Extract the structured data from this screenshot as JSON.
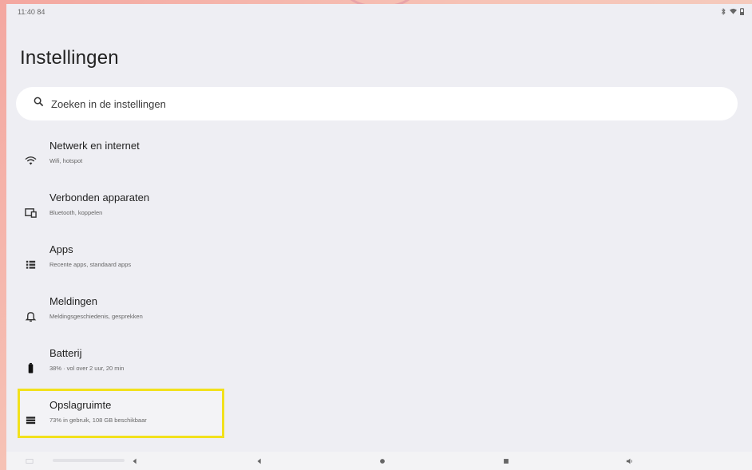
{
  "status_bar": {
    "time": "11:40 84",
    "icons": [
      "bluetooth-icon",
      "wifi-icon",
      "battery-icon"
    ]
  },
  "page_title": "Instellingen",
  "search": {
    "placeholder": "Zoeken in de instellingen",
    "icon": "search-icon"
  },
  "items": [
    {
      "title": "Netwerk en internet",
      "subtitle": "Wifi, hotspot",
      "icon": "wifi-icon"
    },
    {
      "title": "Verbonden apparaten",
      "subtitle": "Bluetooth, koppelen",
      "icon": "connected-devices-icon"
    },
    {
      "title": "Apps",
      "subtitle": "Recente apps, standaard apps",
      "icon": "apps-icon"
    },
    {
      "title": "Meldingen",
      "subtitle": "Meldingsgeschiedenis, gesprekken",
      "icon": "bell-icon"
    },
    {
      "title": "Batterij",
      "subtitle": "38% · vol over 2 uur, 20 min",
      "icon": "battery-icon"
    },
    {
      "title": "Opslagruimte",
      "subtitle": "73% in gebruik, 108 GB beschikbaar",
      "icon": "storage-icon"
    }
  ],
  "nav_bar": {
    "buttons": [
      "keyboard-icon",
      "back-icon",
      "home-icon",
      "recents-icon",
      "volume-icon"
    ]
  },
  "colors": {
    "highlight": "#f2e11c",
    "background": "#eeeef3"
  }
}
